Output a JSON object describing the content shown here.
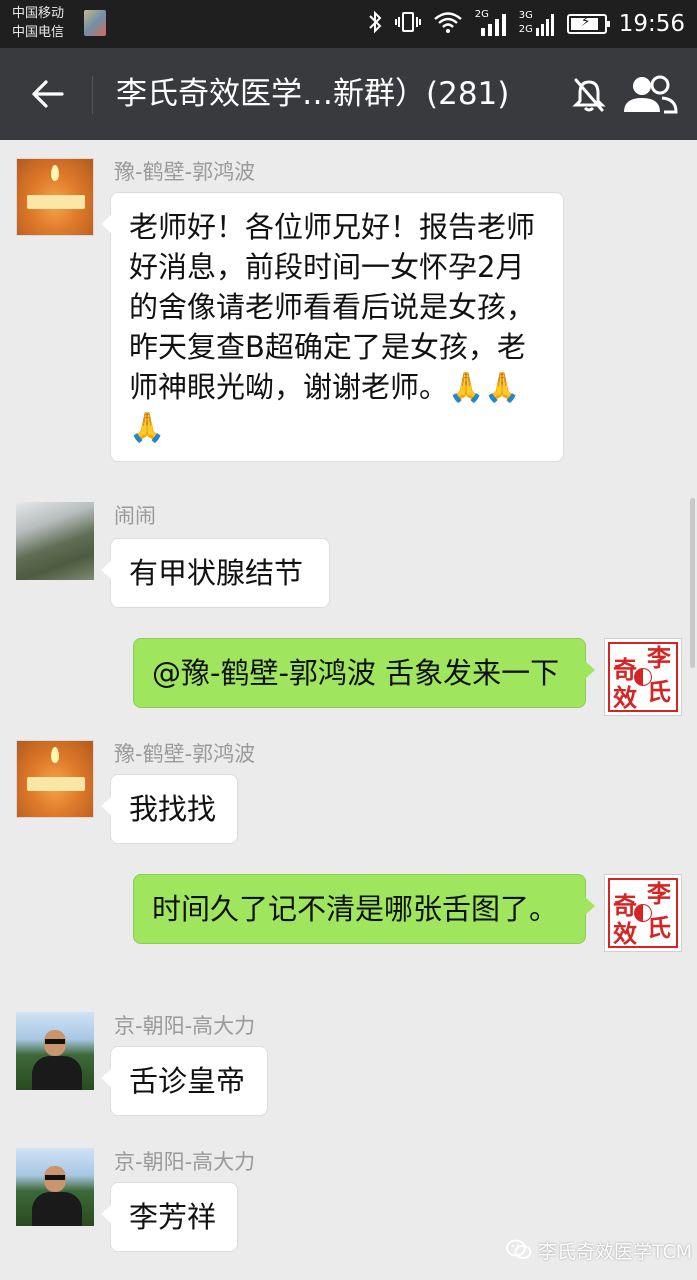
{
  "status_bar": {
    "carrier_1": "中国移动",
    "carrier_2": "中国电信",
    "signal_1_label": "2G",
    "signal_2_label_top": "3G",
    "signal_2_label_bottom": "2G",
    "battery_level": 0.85,
    "time": "19:56"
  },
  "header": {
    "title": "李氏奇效医学…新群）(281)",
    "icons": [
      "back-arrow-icon",
      "mute-icon",
      "group-members-icon"
    ]
  },
  "messages": [
    {
      "side": "left",
      "sender": "豫-鹤壁-郭鸿波",
      "avatar": "candle-avatar",
      "text": "老师好！各位师兄好！报告老师好消息，前段时间一女怀孕2月的舍像请老师看看后说是女孩，昨天复查B超确定了是女孩，老师神眼光呦，谢谢老师。",
      "emoji": "🙏🙏🙏"
    },
    {
      "side": "left",
      "sender": "闹闹",
      "avatar": "photo-avatar",
      "text": "有甲状腺结节"
    },
    {
      "side": "right",
      "avatar": "logo-avatar",
      "text": "@豫-鹤壁-郭鸿波 舌象发来一下"
    },
    {
      "side": "left",
      "sender": "豫-鹤壁-郭鸿波",
      "avatar": "candle-avatar",
      "text": "我找找"
    },
    {
      "side": "right",
      "avatar": "logo-avatar",
      "text": "时间久了记不清是哪张舌图了。"
    },
    {
      "side": "left",
      "sender": "京-朝阳-高大力",
      "avatar": "man-avatar",
      "text": "舌诊皇帝"
    },
    {
      "side": "left",
      "sender": "京-朝阳-高大力",
      "avatar": "man-avatar",
      "text": "李芳祥"
    }
  ],
  "logo_avatar": {
    "chars": [
      "奇",
      "李",
      "效",
      "氏"
    ]
  },
  "watermark": {
    "text": "李氏奇效医学TCM"
  },
  "colors": {
    "status_bar": "#1f1f1f",
    "title_bar": "#393a3e",
    "chat_bg": "#ebebeb",
    "bubble_in": "#ffffff",
    "bubble_out": "#9fe65e",
    "logo_red": "#d52424"
  }
}
